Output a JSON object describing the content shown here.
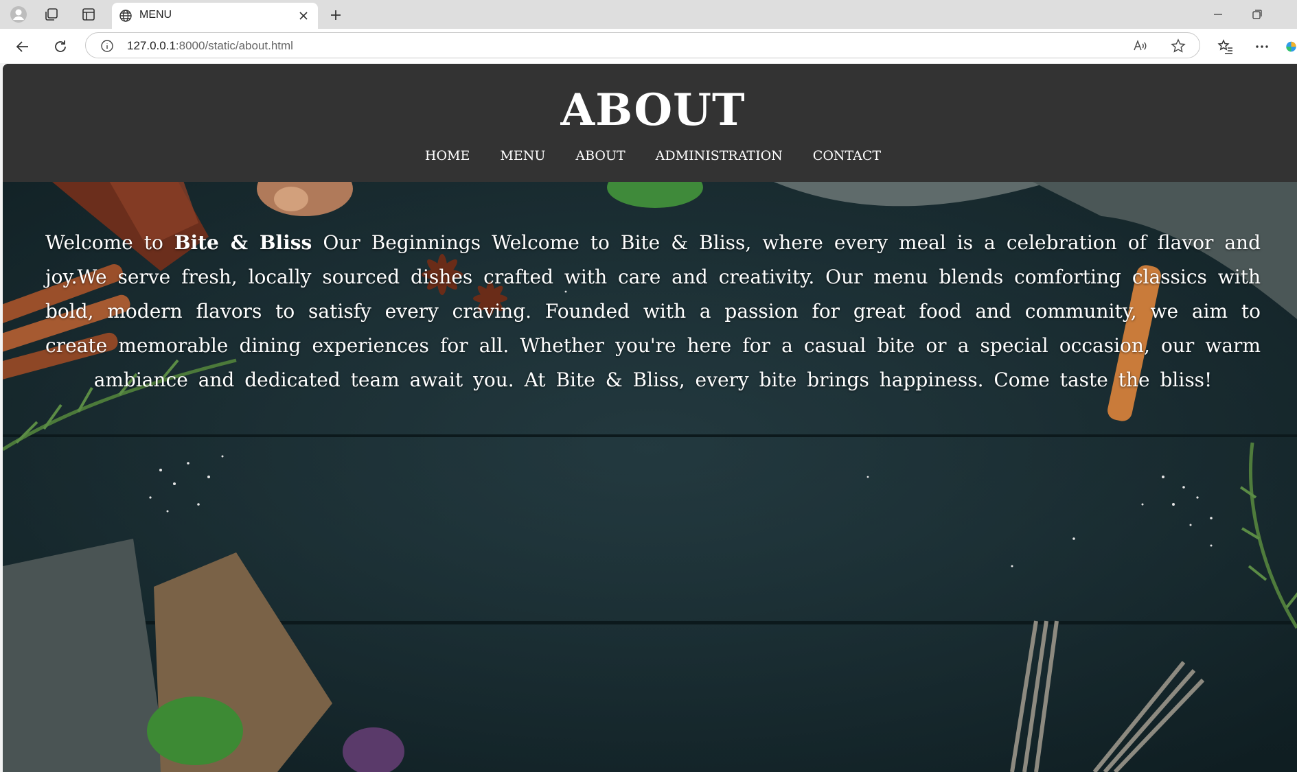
{
  "browser": {
    "tab_title": "MENU",
    "url_host": "127.0.0.1",
    "url_path": ":8000/static/about.html"
  },
  "page": {
    "title": "ABOUT",
    "nav": [
      "HOME",
      "MENU",
      "ABOUT",
      "ADMINISTRATION",
      "CONTACT"
    ],
    "intro_prefix": "Welcome to ",
    "brand": "Bite & Bliss",
    "body_text": " Our Beginnings Welcome to Bite & Bliss, where every meal is a celebration of flavor and joy.We serve fresh, locally sourced dishes crafted with care and creativity. Our menu blends comforting classics with bold, modern flavors to satisfy every craving. Founded with a passion for great food and community, we aim to create memorable dining experiences for all. Whether you're here for a casual bite or a special occasion, our warm ambiance and dedicated team await you. At Bite & Bliss, every bite brings happiness. Come taste the bliss!"
  },
  "colors": {
    "header_bg": "#333333",
    "text": "#ffffff",
    "hero_bg": "#1b3036"
  }
}
